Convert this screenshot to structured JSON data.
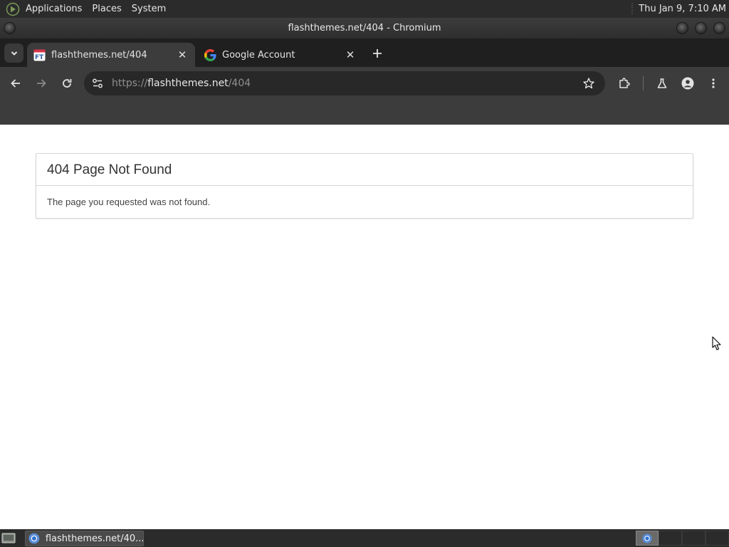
{
  "top_panel": {
    "menus": [
      "Applications",
      "Places",
      "System"
    ],
    "clock": "Thu Jan  9, 7:10 AM"
  },
  "window": {
    "title": "flashthemes.net/404 - Chromium"
  },
  "tabs": [
    {
      "label": "flashthemes.net/404",
      "favicon": "ft-favicon",
      "active": true
    },
    {
      "label": "Google Account",
      "favicon": "google-g-icon",
      "active": false
    }
  ],
  "omnibox": {
    "scheme": "https://",
    "host": "flashthemes.net",
    "path": "/404"
  },
  "page": {
    "heading": "404 Page Not Found",
    "message": "The page you requested was not found."
  },
  "taskbar": {
    "items": [
      {
        "label": "flashthemes.net/40..."
      }
    ]
  },
  "colors": {
    "chrome_dark": "#3c3c3c",
    "tabstrip": "#1f1f1f",
    "omnibox_bg": "#282828",
    "panel_border": "#d6d6d6"
  }
}
